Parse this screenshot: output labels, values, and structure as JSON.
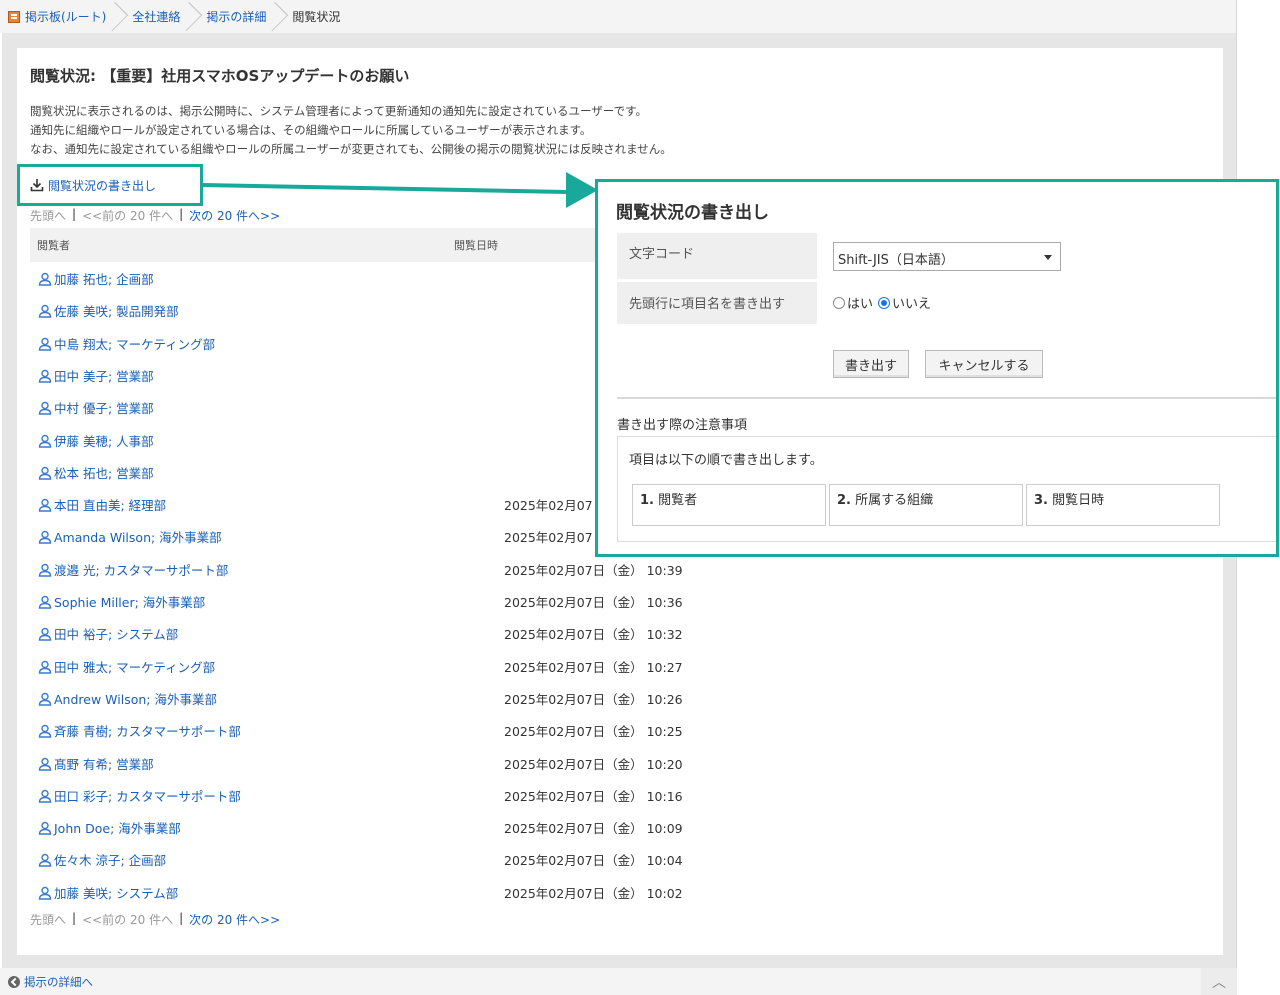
{
  "breadcrumb": {
    "items": [
      "掲示板(ルート)",
      "全社連絡",
      "掲示の詳細",
      "閲覧状況"
    ]
  },
  "page": {
    "title": "閲覧状況: 【重要】社用スマホOSアップデートのお願い",
    "description": [
      "閲覧状況に表示されるのは、掲示公開時に、システム管理者によって更新通知の通知先に設定されているユーザーです。",
      "通知先に組織やロールが設定されている場合は、その組織やロールに所属しているユーザーが表示されます。",
      "なお、通知先に設定されている組織やロールの所属ユーザーが変更されても、公開後の掲示の閲覧状況には反映されません。"
    ],
    "export_link": "閲覧状況の書き出し"
  },
  "pager": {
    "first": "先頭へ",
    "prev": "<<前の 20 件へ",
    "next": "次の 20 件へ>>",
    "separator": "|"
  },
  "table": {
    "headers": [
      "閲覧者",
      "閲覧日時"
    ],
    "rows": [
      {
        "user": "加藤 拓也; 企画部",
        "datetime": ""
      },
      {
        "user": "佐藤 美咲; 製品開発部",
        "datetime": ""
      },
      {
        "user": "中島 翔太; マーケティング部",
        "datetime": ""
      },
      {
        "user": "田中 美子; 営業部",
        "datetime": ""
      },
      {
        "user": "中村 優子; 営業部",
        "datetime": ""
      },
      {
        "user": "伊藤 美穂; 人事部",
        "datetime": ""
      },
      {
        "user": "松本 拓也; 営業部",
        "datetime": ""
      },
      {
        "user": "本田 直由美; 経理部",
        "datetime": "2025年02月07"
      },
      {
        "user": "Amanda Wilson; 海外事業部",
        "datetime": "2025年02月07"
      },
      {
        "user": "渡邉 光; カスタマーサポート部",
        "datetime": "2025年02月07日（金） 10:39"
      },
      {
        "user": "Sophie Miller; 海外事業部",
        "datetime": "2025年02月07日（金） 10:36"
      },
      {
        "user": "田中 裕子; システム部",
        "datetime": "2025年02月07日（金） 10:32"
      },
      {
        "user": "田中 雅太; マーケティング部",
        "datetime": "2025年02月07日（金） 10:27"
      },
      {
        "user": "Andrew Wilson; 海外事業部",
        "datetime": "2025年02月07日（金） 10:26"
      },
      {
        "user": "斉藤 青樹; カスタマーサポート部",
        "datetime": "2025年02月07日（金） 10:25"
      },
      {
        "user": "髙野 有希; 営業部",
        "datetime": "2025年02月07日（金） 10:20"
      },
      {
        "user": "田口 彩子; カスタマーサポート部",
        "datetime": "2025年02月07日（金） 10:16"
      },
      {
        "user": "John Doe; 海外事業部",
        "datetime": "2025年02月07日（金） 10:09"
      },
      {
        "user": "佐々木 涼子; 企画部",
        "datetime": "2025年02月07日（金） 10:04"
      },
      {
        "user": "加藤 美咲; システム部",
        "datetime": "2025年02月07日（金） 10:02"
      }
    ]
  },
  "footer": {
    "back_label": "掲示の詳細へ",
    "scroll_top": "︿"
  },
  "dialog": {
    "title": "閲覧状況の書き出し",
    "charset_label": "文字コード",
    "charset_value": "Shift-JIS（日本語）",
    "header_row_label": "先頭行に項目名を書き出す",
    "radio_yes": "はい",
    "radio_no": "いいえ",
    "radio_selected": "いいえ",
    "export_button": "書き出す",
    "cancel_button": "キャンセルする",
    "notes_title": "書き出す際の注意事項",
    "notes_text": "項目は以下の順で書き出します。",
    "order": [
      {
        "num": "1.",
        "label": "閲覧者"
      },
      {
        "num": "2.",
        "label": "所属する組織"
      },
      {
        "num": "3.",
        "label": "閲覧日時"
      }
    ]
  },
  "colors": {
    "accent": "#18a99b",
    "link": "#1a5fb4"
  }
}
